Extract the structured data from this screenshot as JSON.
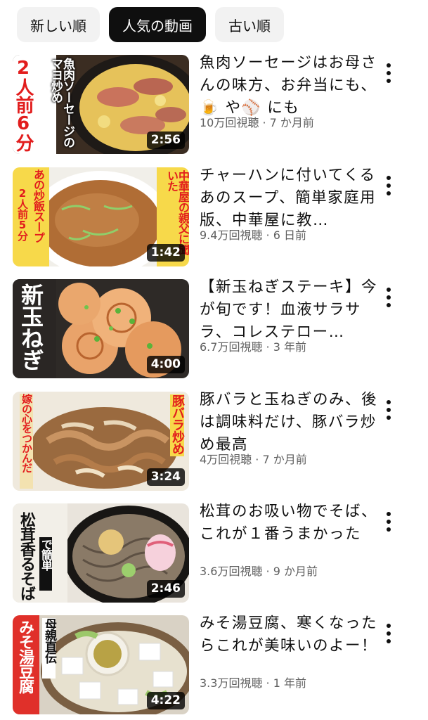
{
  "filters": [
    {
      "label": "新しい順",
      "selected": false
    },
    {
      "label": "人気の動画",
      "selected": true
    },
    {
      "label": "古い順",
      "selected": false
    }
  ],
  "videos": [
    {
      "title": "魚肉ソーセージはお母さんの味方、お弁当にも、🍺 や⚾ にも",
      "meta": "10万回視聴 · 7 か月前",
      "duration": "2:56",
      "thumb_text": [
        "魚肉ソーセージのマヨ炒め",
        "2人前6分"
      ]
    },
    {
      "title": "チャーハンに付いてくるあのスープ、簡単家庭用版、中華屋に教…",
      "meta": "9.4万回視聴 · 6 日前",
      "duration": "1:42",
      "thumb_text": [
        "あの炒飯スープ",
        "2人前5分",
        "中華屋の親父に聞いた"
      ]
    },
    {
      "title": "【新玉ねぎステーキ】今が旬です！血液サラサラ、コレステロー…",
      "meta": "6.7万回視聴 · 3 年前",
      "duration": "4:00",
      "thumb_text": [
        "新玉ねぎ"
      ]
    },
    {
      "title": "豚バラと玉ねぎのみ、後は調味料だけ、豚バラ炒め最高",
      "meta": "4万回視聴 · 7 か月前",
      "duration": "3:24",
      "thumb_text": [
        "嫁の心をつかんだ",
        "豚バラ炒め"
      ]
    },
    {
      "title": "松茸のお吸い物でそば、これが１番うまかった",
      "meta": "3.6万回視聴 · 9 か月前",
      "duration": "2:46",
      "thumb_text": [
        "松茸香るそば",
        "で簡単"
      ]
    },
    {
      "title": "みそ湯豆腐、寒くなったらこれが美味いのよー！",
      "meta": "3.3万回視聴 · 1 年前",
      "duration": "4:22",
      "thumb_text": [
        "みそ湯豆腐",
        "母親直伝"
      ]
    }
  ]
}
